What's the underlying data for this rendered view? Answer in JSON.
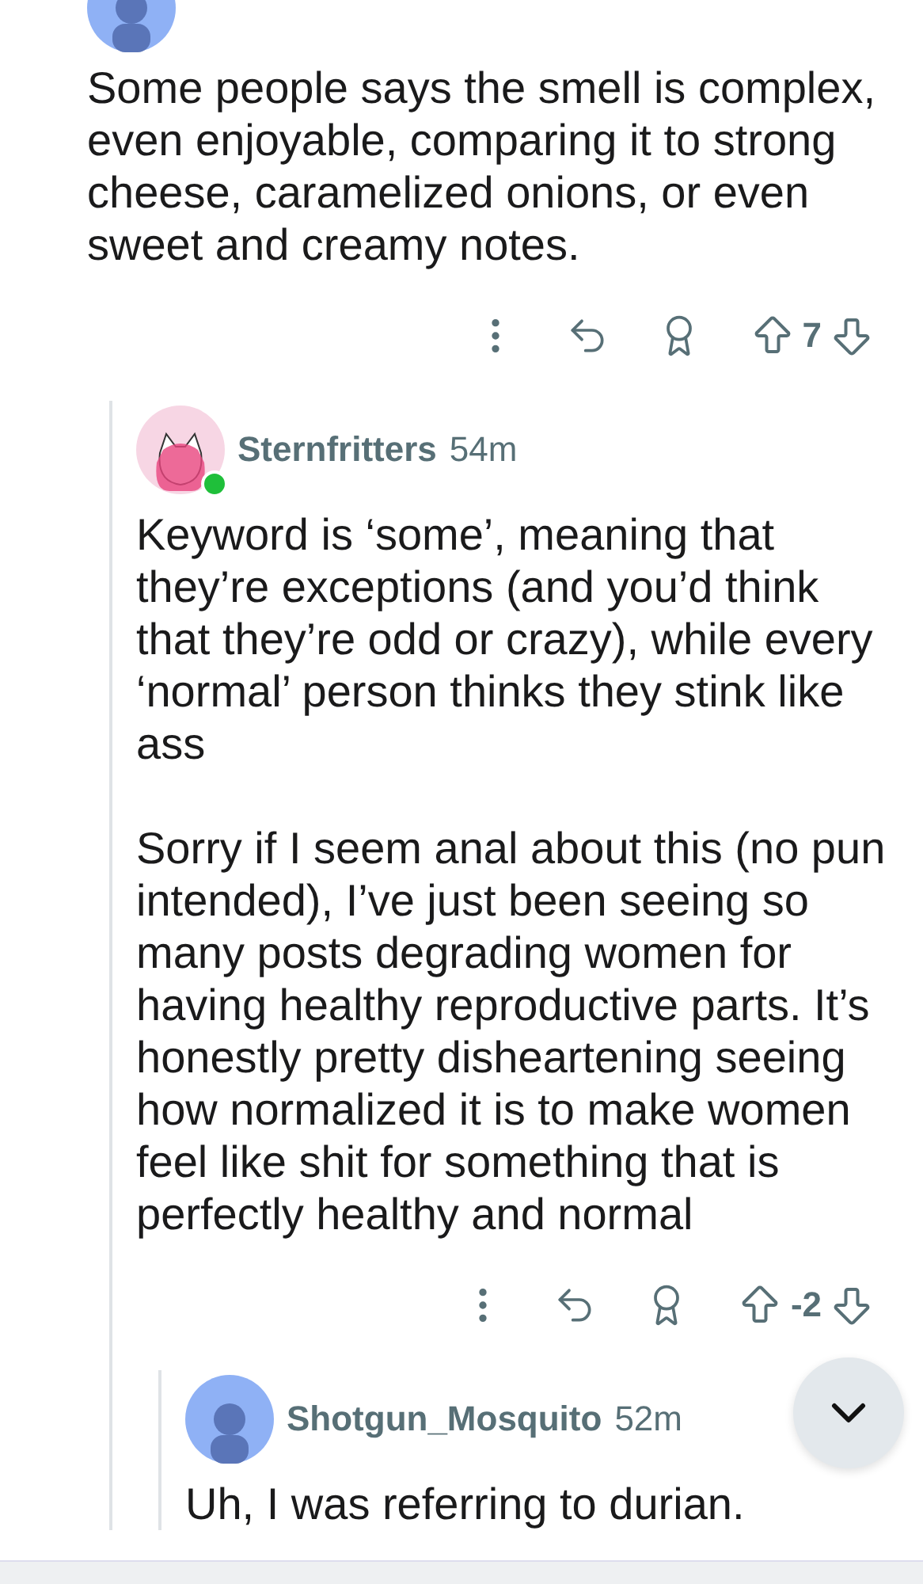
{
  "comments": [
    {
      "kind": "default",
      "online": false,
      "body": [
        "Some people says the smell is complex, even enjoyable, comparing it to strong cheese, caramelized onions, or even sweet and creamy notes."
      ],
      "score": "7",
      "children": [
        {
          "author": "Sternfritters",
          "time": "54m",
          "kind": "cat",
          "online": true,
          "body": [
            "Keyword is ‘some’, meaning that they’re exceptions (and you’d think that they’re odd or crazy), while every ‘normal’ person thinks they stink like ass",
            "Sorry if I seem anal about this (no pun intended), I’ve just been seeing so many posts degrading women for having healthy reproductive parts. It’s honestly pretty disheartening seeing how normalized it is to make women feel like shit for something that is perfectly healthy and normal"
          ],
          "score": "-2",
          "children": [
            {
              "author": "Shotgun_Mosquito",
              "time": "52m",
              "kind": "default",
              "online": false,
              "body": [
                "Uh, I was referring to durian."
              ]
            }
          ]
        }
      ]
    }
  ]
}
